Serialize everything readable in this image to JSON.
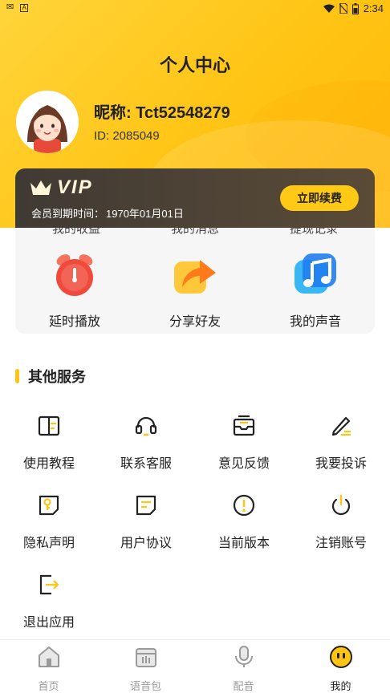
{
  "status_bar": {
    "left_glyph_1": "✉",
    "left_glyph_2": "A",
    "time": "2:34"
  },
  "header": {
    "title": "个人中心"
  },
  "profile": {
    "nickname": "昵称: Tct52548279",
    "id_text": "ID: 2085049"
  },
  "vip": {
    "logo_text": "VIP",
    "expire_label": "会员到期时间：",
    "expire_date": "1970年01月01日",
    "renew_label": "立即续费"
  },
  "features": {
    "cut_off_labels": [
      "我的收益",
      "我的消息",
      "提现记录"
    ],
    "items": [
      {
        "label": "延时播放",
        "icon": "alarm-clock-icon"
      },
      {
        "label": "分享好友",
        "icon": "share-arrow-icon"
      },
      {
        "label": "我的声音",
        "icon": "music-note-icon"
      }
    ]
  },
  "services": {
    "title": "其他服务",
    "items": [
      {
        "label": "使用教程",
        "icon": "book-icon"
      },
      {
        "label": "联系客服",
        "icon": "headset-icon"
      },
      {
        "label": "意见反馈",
        "icon": "feedback-inbox-icon"
      },
      {
        "label": "我要投诉",
        "icon": "pencil-edit-icon"
      },
      {
        "label": "隐私声明",
        "icon": "privacy-key-icon"
      },
      {
        "label": "用户协议",
        "icon": "agreement-doc-icon"
      },
      {
        "label": "当前版本",
        "icon": "info-exclamation-icon"
      },
      {
        "label": "注销账号",
        "icon": "power-icon"
      },
      {
        "label": "退出应用",
        "icon": "exit-icon"
      }
    ]
  },
  "bottom_nav": {
    "items": [
      {
        "label": "首页",
        "icon": "home-icon",
        "active": false
      },
      {
        "label": "语音包",
        "icon": "voice-pack-icon",
        "active": false
      },
      {
        "label": "配音",
        "icon": "microphone-icon",
        "active": false
      },
      {
        "label": "我的",
        "icon": "profile-face-icon",
        "active": true
      }
    ]
  },
  "colors": {
    "accent": "#ffc414",
    "vip_card": "#4a4139",
    "text_primary": "#222222",
    "nav_inactive": "#9a9a9a"
  }
}
